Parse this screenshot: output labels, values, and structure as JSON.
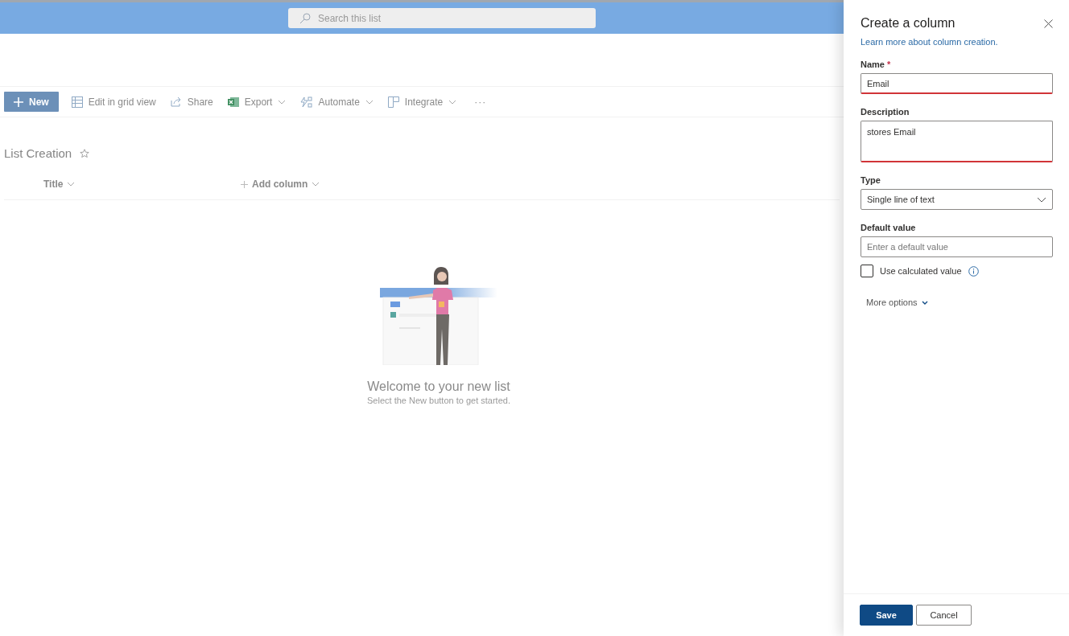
{
  "search": {
    "placeholder": "Search this list"
  },
  "command_bar": [
    {
      "label": "New",
      "kind": "new",
      "dropdown": false
    },
    {
      "label": "Edit in grid view",
      "kind": "grid",
      "dropdown": false
    },
    {
      "label": "Share",
      "kind": "share",
      "dropdown": false
    },
    {
      "label": "Export",
      "kind": "export",
      "dropdown": true
    },
    {
      "label": "Automate",
      "kind": "automate",
      "dropdown": true
    },
    {
      "label": "Integrate",
      "kind": "integrate",
      "dropdown": true
    },
    {
      "label": "···",
      "kind": "more",
      "dropdown": false
    }
  ],
  "list": {
    "title": "List Creation",
    "columns": [
      {
        "label": "Title",
        "kind": "column"
      },
      {
        "label": "Add column",
        "kind": "add"
      }
    ]
  },
  "empty_state": {
    "heading": "Welcome to your new list",
    "subtext": "Select the New button to get started."
  },
  "panel": {
    "title": "Create a column",
    "link": "Learn more about column creation.",
    "fields": [
      {
        "kind": "text",
        "label": "Name",
        "required_mark": "*",
        "value": "Email",
        "error": true
      },
      {
        "kind": "textarea",
        "label": "Description",
        "value": "stores Email",
        "error": true
      },
      {
        "kind": "dropdown",
        "label": "Type",
        "value": "Single line of text"
      },
      {
        "kind": "text",
        "label": "Default value",
        "placeholder": "Enter a default value",
        "error": false
      },
      {
        "kind": "checkbox",
        "label": "Use calculated value",
        "checked": false
      }
    ],
    "more_options": "More options",
    "buttons": [
      {
        "label": "Save",
        "kind": "primary"
      },
      {
        "label": "Cancel",
        "kind": "default"
      }
    ]
  }
}
